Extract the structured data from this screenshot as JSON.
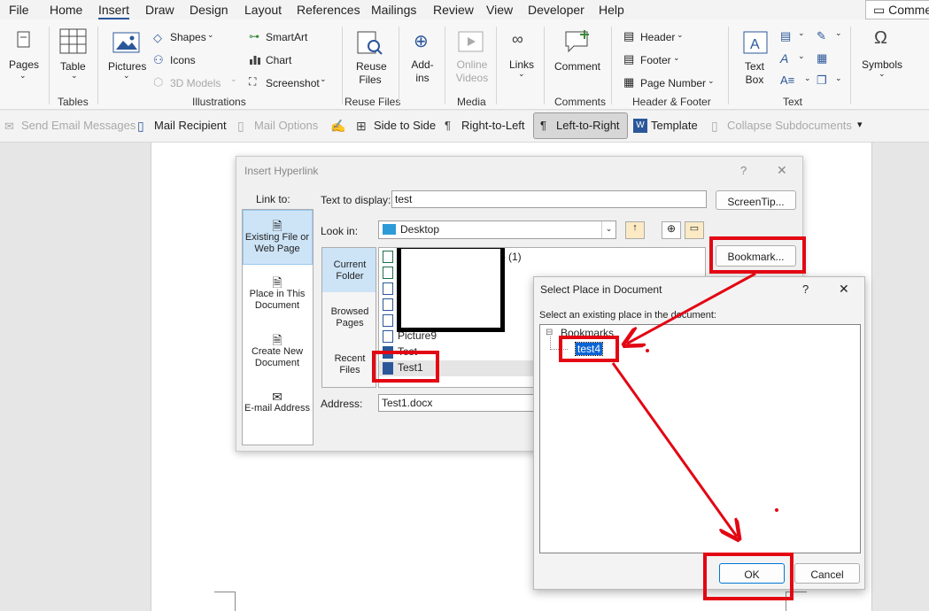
{
  "menu": {
    "tabs": [
      "File",
      "Home",
      "Insert",
      "Draw",
      "Design",
      "Layout",
      "References",
      "Mailings",
      "Review",
      "View",
      "Developer",
      "Help"
    ],
    "active_tab": "Insert",
    "comments_button": "Comme"
  },
  "ribbon": {
    "pages": "Pages",
    "table": "Table",
    "pictures": "Pictures",
    "shapes": "Shapes",
    "icons": "Icons",
    "models_3d": "3D Models",
    "smartart": "SmartArt",
    "chart": "Chart",
    "screenshot": "Screenshot",
    "reuse_files": "Reuse Files",
    "addins": "Add-ins",
    "online_videos": "Online Videos",
    "links": "Links",
    "comment": "Comment",
    "header": "Header",
    "footer": "Footer",
    "page_number": "Page Number",
    "text_box": "Text Box",
    "symbols": "Symbols",
    "groups": {
      "tables": "Tables",
      "illustrations": "Illustrations",
      "reuse_files": "Reuse Files",
      "media": "Media",
      "comments": "Comments",
      "header_footer": "Header & Footer",
      "text": "Text"
    }
  },
  "toolbar": {
    "send_email": "Send Email Messages",
    "mail_recipient": "Mail Recipient",
    "mail_options": "Mail Options",
    "side_to_side": "Side to Side",
    "rtl": "Right-to-Left",
    "ltr": "Left-to-Right",
    "template": "Template",
    "collapse": "Collapse Subdocuments"
  },
  "hyperlink_dialog": {
    "title": "Insert Hyperlink",
    "help": "?",
    "close": "✕",
    "link_to_label": "Link to:",
    "link_options": [
      "Existing File or Web Page",
      "Place in This Document",
      "Create New Document",
      "E-mail Address"
    ],
    "text_to_display_label": "Text to display:",
    "text_to_display_value": "test",
    "screentip_button": "ScreenTip...",
    "look_in_label": "Look in:",
    "look_in_value": "Desktop",
    "lookin_tabs": [
      "Current Folder",
      "Browsed Pages",
      "Recent Files"
    ],
    "files": [
      "sb (1)",
      "Picture9",
      "Test",
      "Test1"
    ],
    "bookmark_button": "Bookmark...",
    "address_label": "Address:",
    "address_value": "Test1.docx"
  },
  "place_dialog": {
    "title": "Select Place in Document",
    "help": "?",
    "close": "✕",
    "instruction": "Select an existing place in the document:",
    "tree_root": "Bookmarks",
    "tree_root_toggle": "⊟",
    "selected_bookmark": "test4",
    "ok_button": "OK",
    "cancel_button": "Cancel"
  },
  "colors": {
    "annotation_red": "#e30613",
    "accent_blue": "#2b579a",
    "selection_blue": "#0a64d6"
  }
}
